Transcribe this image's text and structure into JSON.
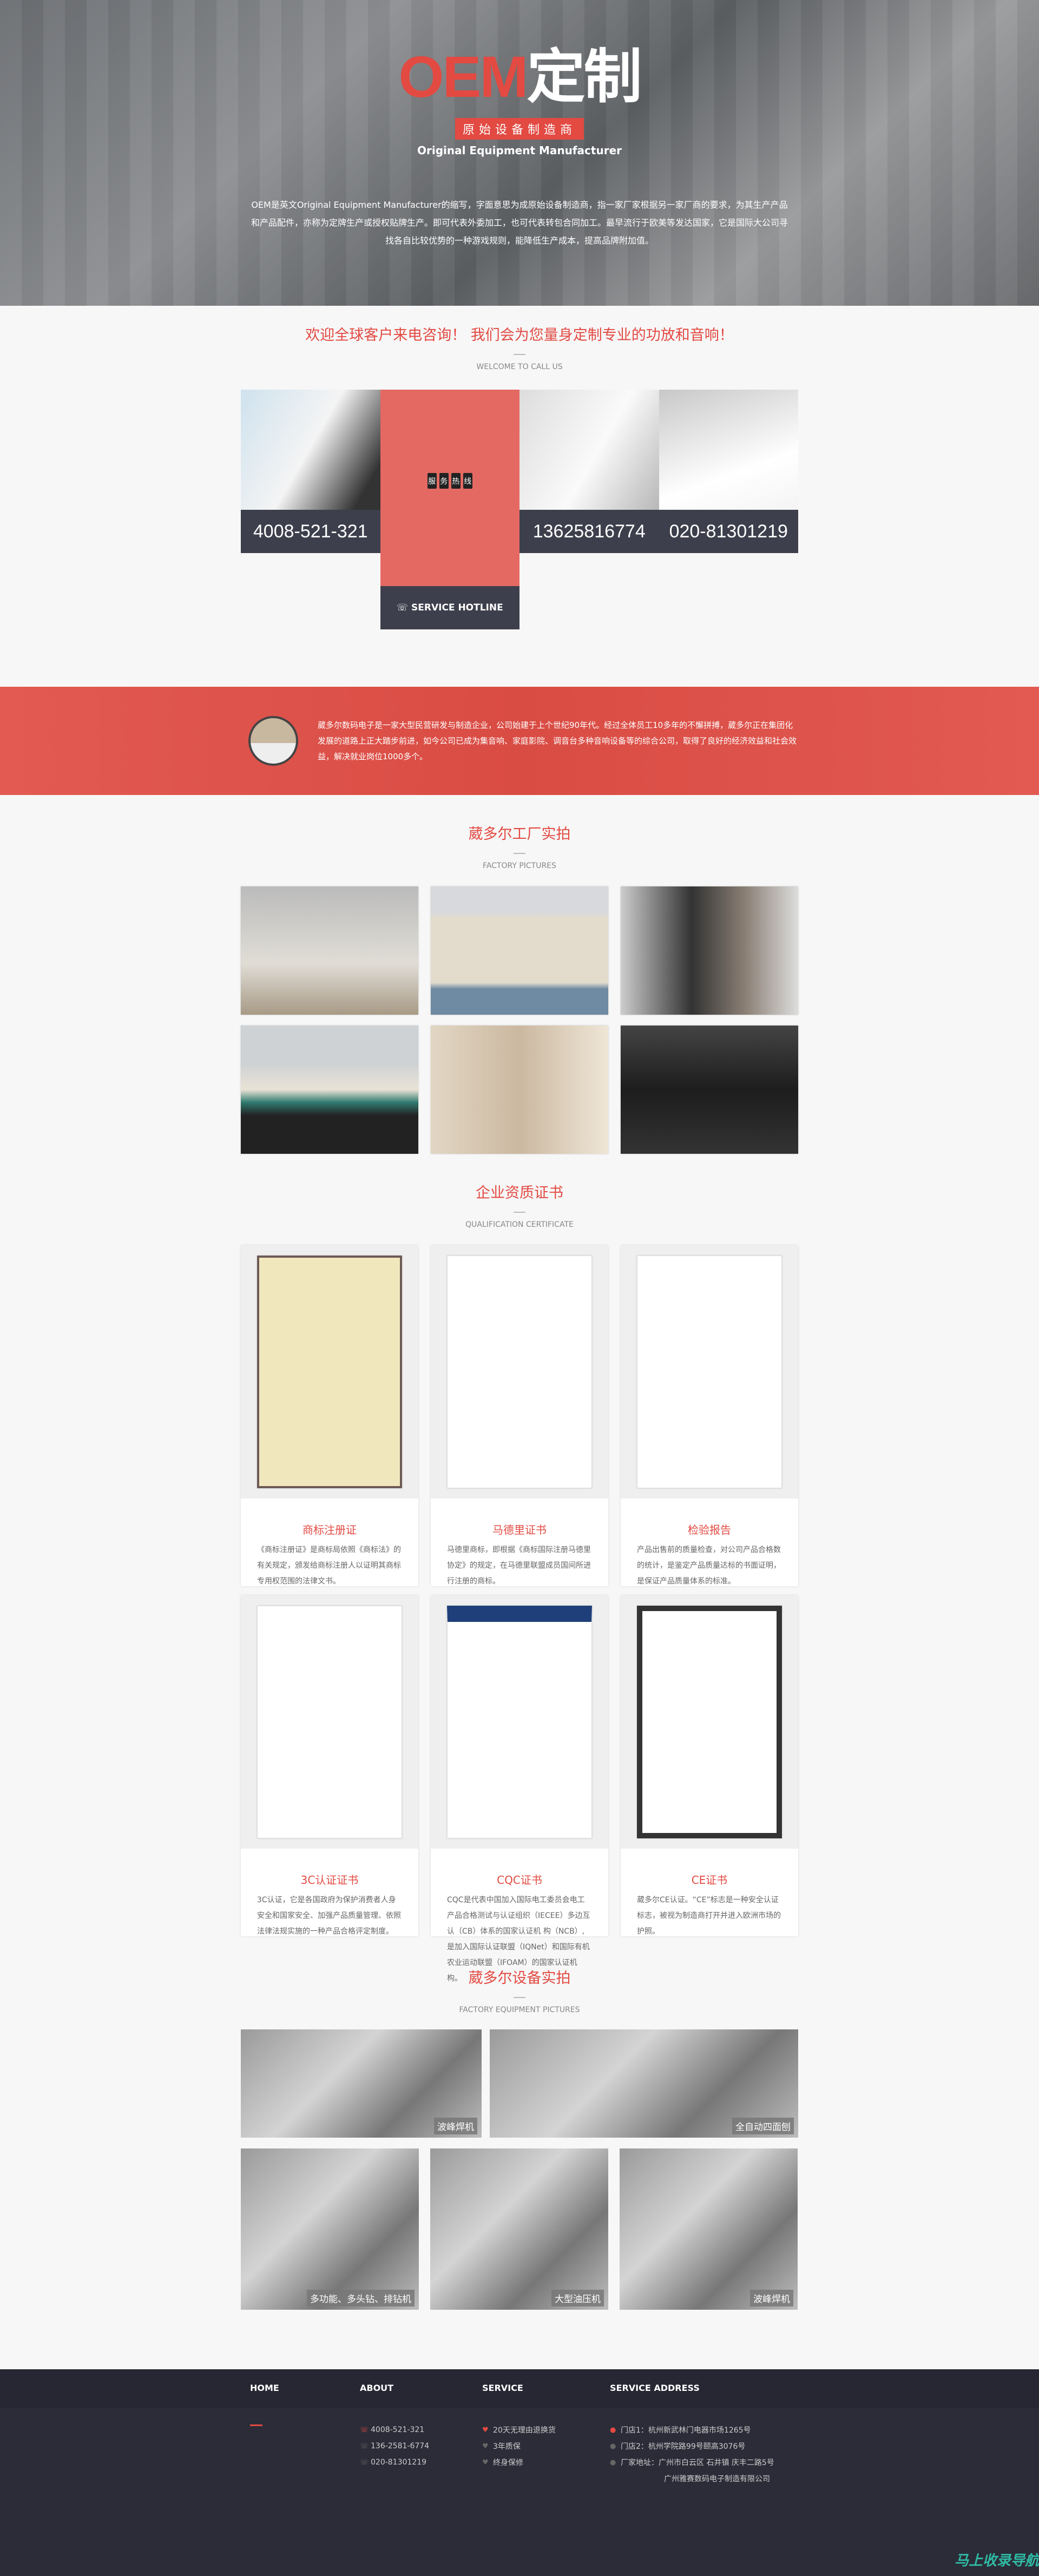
{
  "hero": {
    "title_red": "OEM",
    "title_white": "定制",
    "badge": "原始设备制造商",
    "subtitle": "Original Equipment Manufacturer",
    "description": "OEM是英文Original Equipment Manufacturer的缩写，字面意思为成原始设备制造商，指一家厂家根据另一家厂商的要求，为其生产产品和产品配件，亦称为定牌生产或授权贴牌生产。即可代表外委加工，也可代表转包合同加工。最早流行于欧美等发达国家，它是国际大公司寻找各自比较优势的一种游戏规则，能降低生产成本，提高品牌附加值。"
  },
  "welcome": {
    "title": "欢迎全球客户来电咨询！ 我们会为您量身定制专业的功放和音响！",
    "subtitle": "WELCOME TO CALL US",
    "phone1": "4008-521-321",
    "hotline_chars": [
      "服",
      "务",
      "热",
      "线"
    ],
    "service_hotline": "SERVICE HOTLINE",
    "phone2": "13625816774",
    "phone3": "020-81301219"
  },
  "about": {
    "text": "葳多尔数码电子是一家大型民营研发与制造企业，公司始建于上个世纪90年代。经过全体员工10多年的不懈拼搏，葳多尔正在集团化发展的道路上正大踏步前进，如今公司已成为集音响、家庭影院、调音台多种音响设备等的综合公司，取得了良好的经济效益和社会效益，解决就业岗位1000多个。"
  },
  "factory": {
    "title": "葳多尔工厂实拍",
    "subtitle": "FACTORY PICTURES"
  },
  "certs": {
    "title": "企业资质证书",
    "subtitle": "QUALIFICATION CERTIFICATE",
    "items": [
      {
        "name": "商标注册证",
        "desc": "《商标注册证》是商标局依照《商标法》的有关规定，颁发给商标注册人以证明其商标专用权范围的法律文书。"
      },
      {
        "name": "马德里证书",
        "desc": "马德里商标，即根据《商标国际注册马德里协定》的规定，在马德里联盟成员国间所进行注册的商标。"
      },
      {
        "name": "检验报告",
        "desc": "产品出售前的质量检查，对公司产品合格数的统计，是鉴定产品质量达标的书面证明，是保证产品质量体系的标准。"
      },
      {
        "name": "3C认证证书",
        "desc": "3C认证，它是各国政府为保护消费者人身安全和国家安全、加强产品质量管理、依照法律法规实施的一种产品合格评定制度。"
      },
      {
        "name": "CQC证书",
        "desc": "CQC是代表中国加入国际电工委员会电工产品合格测试与认证组织（IECEE）多边互认（CB）体系的国家认证机 构（NCB）,是加入国际认证联盟（IQNet）和国际有机农业运动联盟（IFOAM）的国家认证机构。"
      },
      {
        "name": "CE证书",
        "desc": "葳多尔CE认证。“CE”标志是一种安全认证标志，被视为制造商打开并进入欧洲市场的护照。"
      }
    ]
  },
  "equipment": {
    "title": "葳多尔设备实拍",
    "subtitle": "FACTORY EQUIPMENT PICTURES",
    "captions": [
      "波峰焊机",
      "全自动四面刨",
      "多功能、多头钻、排钻机",
      "大型油压机",
      "波峰焊机"
    ]
  },
  "footer": {
    "home": "HOME",
    "about": "ABOUT",
    "service": "SERVICE",
    "address": "SERVICE ADDRESS",
    "phones": [
      "4008-521-321",
      "136-2581-6774",
      "020-81301219"
    ],
    "services": [
      "20天无理由退换货",
      "3年质保",
      "终身保修"
    ],
    "addresses": [
      "门店1：杭州新武林门电器市场1265号",
      "门店2：杭州学院路99号颐高3076号",
      "厂家地址：广州市白云区 石井镇 庆丰二路5号"
    ],
    "company": "广州雅赛数码电子制造有限公司",
    "watermark": "马上收录导航"
  },
  "colors": {
    "accent": "#e24a42",
    "dark": "#3e3f4c",
    "footer": "#2b2c38"
  }
}
